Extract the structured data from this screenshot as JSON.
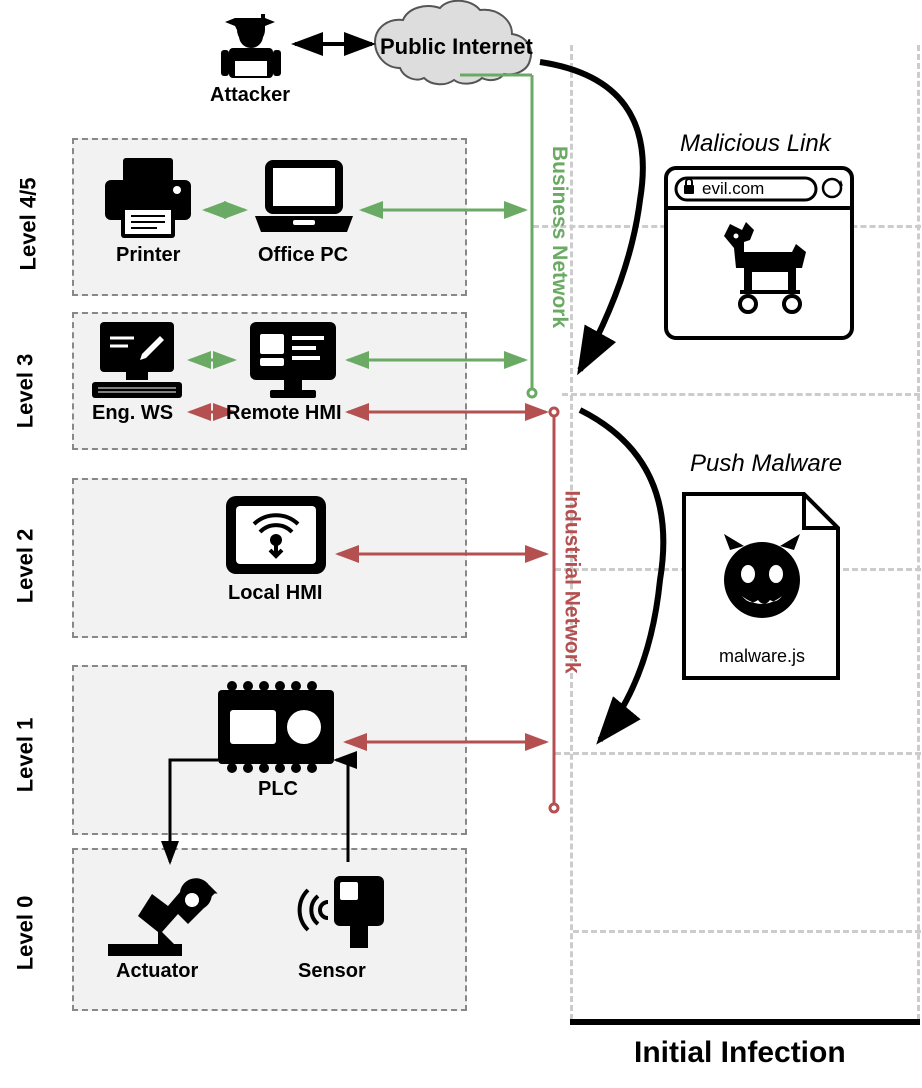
{
  "labels": {
    "attacker": "Attacker",
    "internet": "Public Internet",
    "level45": "Level 4/5",
    "level3": "Level 3",
    "level2": "Level 2",
    "level1": "Level 1",
    "level0": "Level 0",
    "printer": "Printer",
    "officepc": "Office PC",
    "engws": "Eng. WS",
    "remotehmi": "Remote HMI",
    "localhmi": "Local HMI",
    "plc": "PLC",
    "actuator": "Actuator",
    "sensor": "Sensor",
    "bizNet": "Business Network",
    "indNet": "Industrial Network",
    "maliciousLink": "Malicious Link",
    "pushMalware": "Push Malware",
    "evilUrl": "evil.com",
    "malwareFile": "malware.js",
    "initialInfection": "Initial Infection"
  },
  "colors": {
    "green": "#6aaa64",
    "red": "#b55050",
    "gray": "#888"
  }
}
